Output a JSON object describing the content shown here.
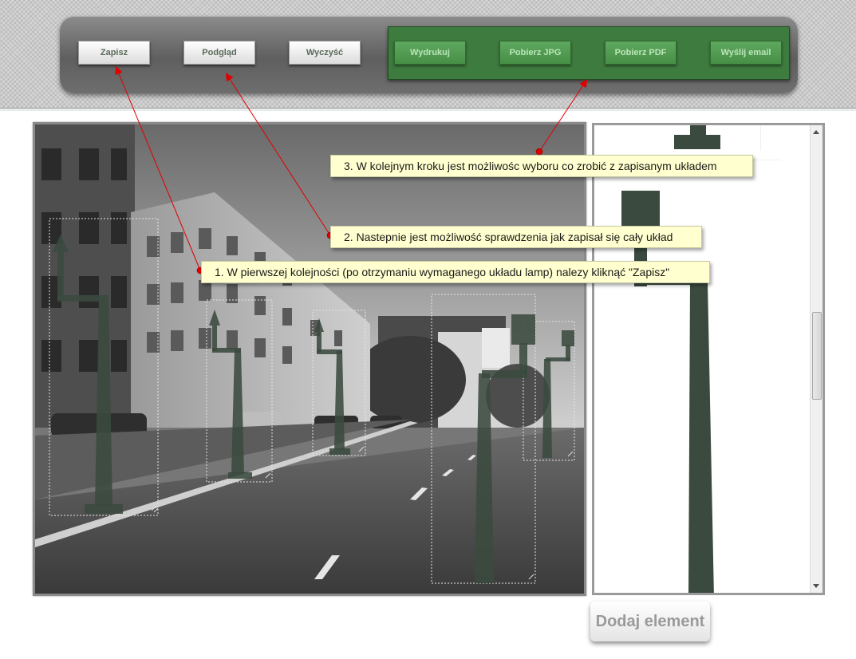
{
  "toolbar": {
    "buttons": [
      "Zapisz",
      "Podgląd",
      "Wyczyść"
    ],
    "export_buttons": [
      "Wydrukuj",
      "Pobierz JPG",
      "Pobierz PDF",
      "Wyślij email"
    ]
  },
  "notes": [
    "3. W kolejnym kroku jest możliwośc wyboru co zrobić z zapisanym układem",
    "2. Nastepnie jest możliwość sprawdzenia jak zapisał się cały układ",
    "1. W pierwszej kolejności (po otrzymaniu wymaganego układu lamp) nalezy kliknąć \"Zapisz\""
  ],
  "side_panel": {
    "add_button_label": "Dodaj element"
  },
  "colors": {
    "toolbar_green": "#3e7b3e",
    "lamp_color": "#3b4a3f",
    "note_background": "#ffffcf",
    "annotation_red": "#e00000"
  }
}
